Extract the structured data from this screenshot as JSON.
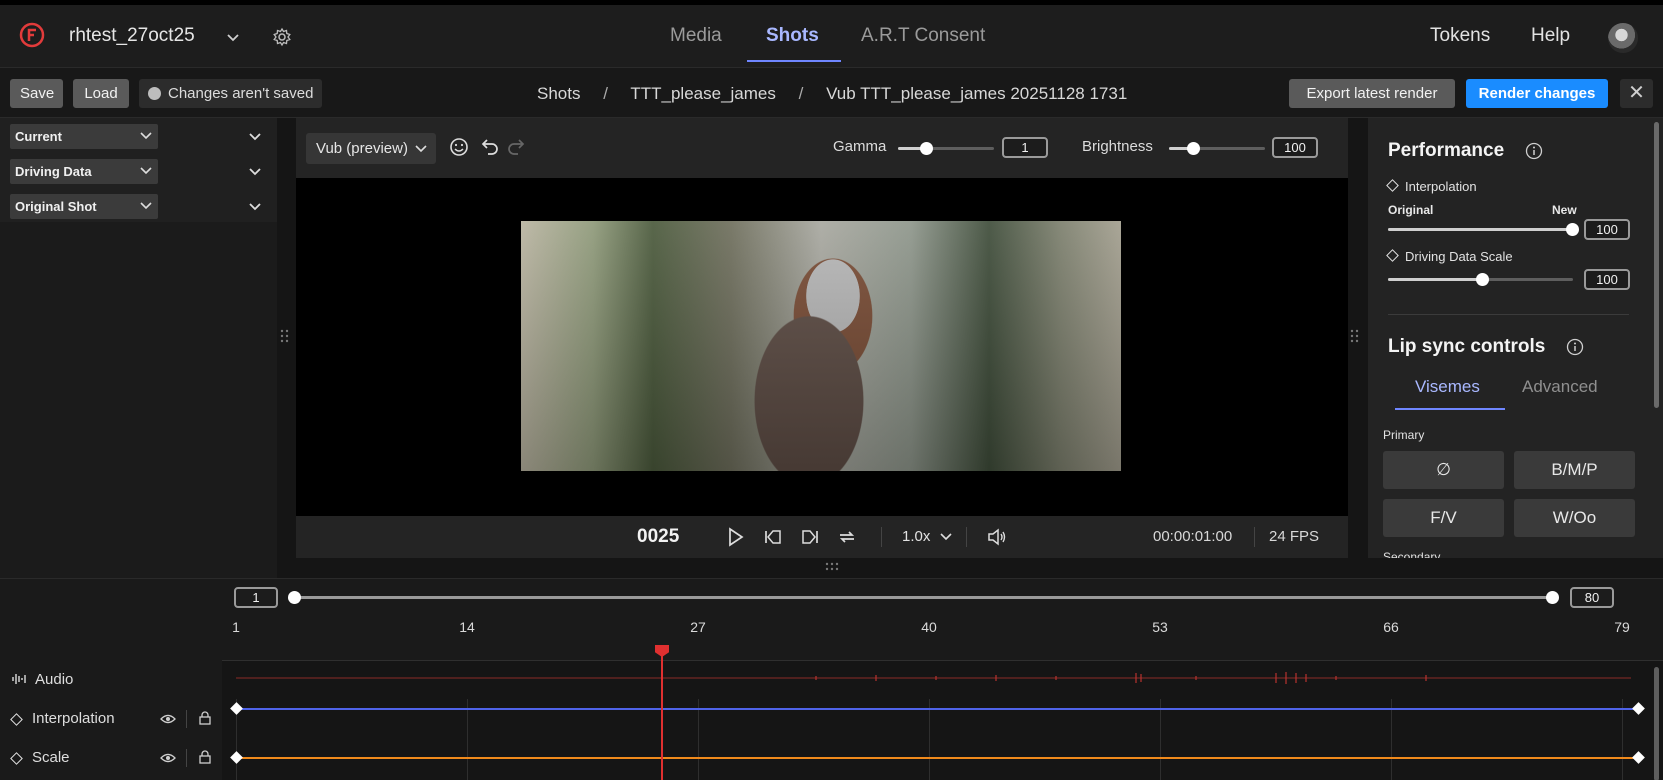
{
  "app": {
    "project_name": "rhtest_27oct25",
    "nav_tabs": [
      "Media",
      "Shots",
      "A.R.T Consent"
    ],
    "active_tab": "Shots",
    "top_links": [
      "Tokens",
      "Help"
    ],
    "accent": "#6f86ff"
  },
  "toolbar": {
    "save_label": "Save",
    "load_label": "Load",
    "status_text": "Changes aren't saved",
    "breadcrumb": [
      "Shots",
      "TTT_please_james",
      "Vub TTT_please_james 20251128 1731"
    ],
    "breadcrumb_sep": "/",
    "export_label": "Export latest render",
    "render_label": "Render changes",
    "render_color": "#1a8cff",
    "close_glyph": "✕"
  },
  "left_panel": {
    "dropdowns": [
      "Current",
      "Driving Data",
      "Original Shot"
    ]
  },
  "viewer": {
    "mode_label": "Vub (preview)",
    "gamma_label": "Gamma",
    "gamma_value": "1",
    "gamma_level": 0.3,
    "brightness_label": "Brightness",
    "brightness_value": "100",
    "brightness_level": 0.25,
    "icons": [
      "face-icon",
      "undo-icon",
      "redo-icon"
    ]
  },
  "transport": {
    "frame": "0025",
    "speed": "1.0x",
    "timecode": "00:00:01:00",
    "fps": "24 FPS"
  },
  "right_panel": {
    "performance_title": "Performance",
    "interpolation_label": "Interpolation",
    "original_label": "Original",
    "new_label": "New",
    "interpolation_value": "100",
    "interpolation_level": 1.0,
    "driving_scale_label": "Driving Data Scale",
    "driving_scale_value": "100",
    "driving_scale_level": 0.5,
    "lipsync_title": "Lip sync controls",
    "tabs": [
      "Visemes",
      "Advanced"
    ],
    "primary_label": "Primary",
    "visemes": [
      "∅",
      "B/M/P",
      "F/V",
      "W/Oo"
    ],
    "secondary_label": "Secondary"
  },
  "timeline": {
    "range_start": "1",
    "range_end": "80",
    "ticks": [
      "1",
      "14",
      "27",
      "40",
      "53",
      "66",
      "79"
    ],
    "tracks": [
      {
        "name": "Audio",
        "color": "#b8332f"
      },
      {
        "name": "Interpolation",
        "color": "#4f63e8"
      },
      {
        "name": "Scale",
        "color": "#f08a1c"
      }
    ],
    "playhead_frame": 25
  }
}
